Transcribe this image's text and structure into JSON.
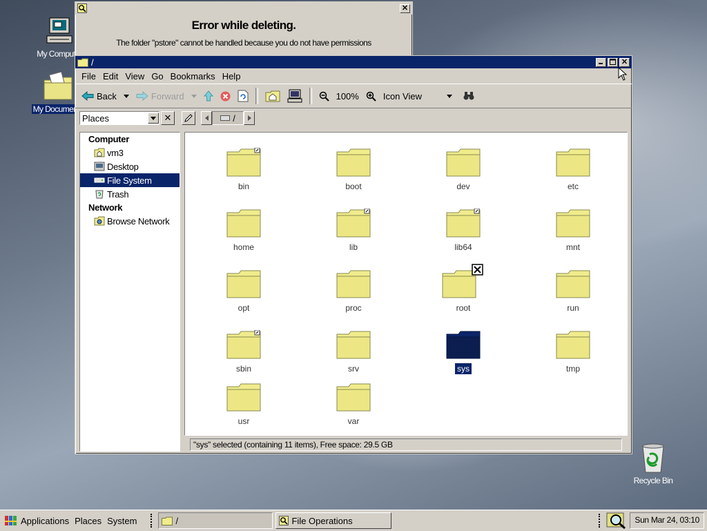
{
  "desktop": {
    "icons": [
      {
        "label": "My Computer"
      },
      {
        "label": "My Documents"
      },
      {
        "label": "Recycle Bin"
      }
    ]
  },
  "error_dialog": {
    "heading": "Error while deleting.",
    "message": "The folder \"pstore\" cannot be handled because you do not have permissions"
  },
  "file_window": {
    "title": "/",
    "menu": [
      "File",
      "Edit",
      "View",
      "Go",
      "Bookmarks",
      "Help"
    ],
    "toolbar": {
      "back": "Back",
      "forward": "Forward",
      "zoom": "100%",
      "view_mode": "Icon View"
    },
    "location": {
      "side_combo": "Places",
      "path_segment": "/"
    },
    "sidebar": {
      "computer_header": "Computer",
      "computer_items": [
        "vm3",
        "Desktop",
        "File System",
        "Trash"
      ],
      "network_header": "Network",
      "network_items": [
        "Browse Network"
      ]
    },
    "folders": [
      "bin",
      "boot",
      "dev",
      "etc",
      "home",
      "lib",
      "lib64",
      "mnt",
      "opt",
      "proc",
      "root",
      "run",
      "sbin",
      "srv",
      "sys",
      "tmp",
      "usr",
      "var"
    ],
    "status": "\"sys\" selected (containing 11 items), Free space: 29.5 GB"
  },
  "taskbar": {
    "menus": [
      "Applications",
      "Places",
      "System"
    ],
    "tasks": [
      "/",
      "File Operations"
    ],
    "clock": "Sun Mar 24, 03:10"
  },
  "colors": {
    "selection": "#0a246a",
    "folder_yellow": "#f0ec8c",
    "chrome": "#d4d0c8"
  }
}
